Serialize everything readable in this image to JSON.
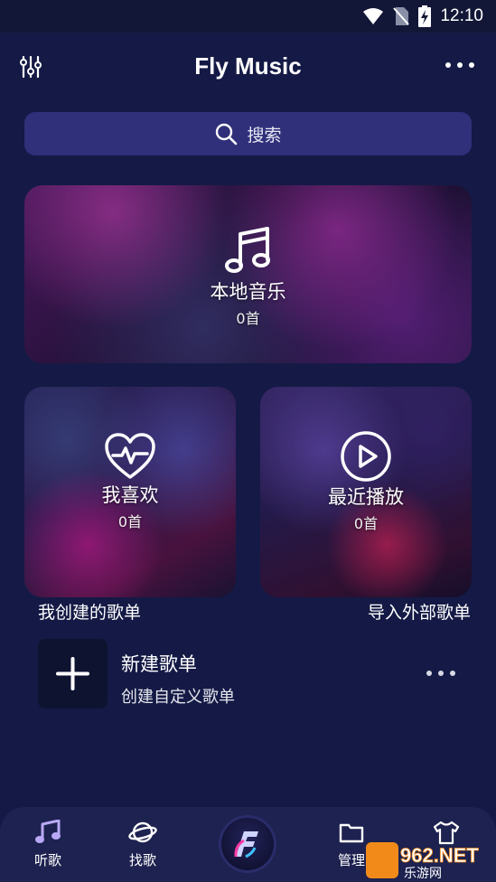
{
  "status_bar": {
    "time": "12:10"
  },
  "header": {
    "title": "Fly Music"
  },
  "search": {
    "label": "搜索"
  },
  "cards": {
    "local": {
      "name": "本地音乐",
      "count": "0首"
    },
    "favorites": {
      "name": "我喜欢",
      "count": "0首"
    },
    "recent": {
      "name": "最近播放",
      "count": "0首"
    }
  },
  "sections": {
    "my_playlists": "我创建的歌单",
    "import": "导入外部歌单"
  },
  "new_playlist": {
    "title": "新建歌单",
    "subtitle": "创建自定义歌单"
  },
  "bottom_nav": {
    "items": [
      {
        "label": "听歌",
        "icon": "music-note-icon"
      },
      {
        "label": "找歌",
        "icon": "planet-icon"
      },
      {
        "label": "",
        "icon": "fly-logo-icon"
      },
      {
        "label": "管理",
        "icon": "folder-icon"
      },
      {
        "label": "",
        "icon": "shirt-icon"
      }
    ]
  },
  "watermark": {
    "text_top": "962.NET",
    "text_bottom": "乐游网"
  },
  "colors": {
    "background": "#141a45",
    "search_bg": "#2f2f7a",
    "nav_bg": "#1d2250"
  }
}
